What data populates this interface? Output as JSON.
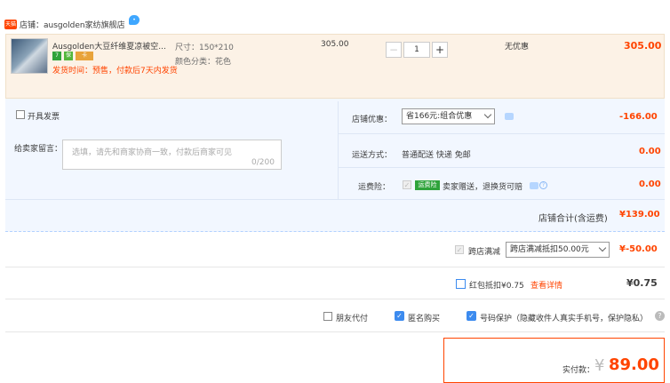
{
  "shop": {
    "badge": "天猫",
    "name": "店铺：ausgolden家纺旗舰店",
    "chat_icon": "chat-bubble-icon"
  },
  "item": {
    "title": "Ausgolden大豆纤维夏凉被空...",
    "tags": [
      "7",
      "保",
      "卡"
    ],
    "ship_note": "发货时间：预售，付款后7天内发货",
    "sku_size": "尺寸：150*210",
    "sku_color": "颜色分类：花色",
    "unit_price": "305.00",
    "quantity": "1",
    "minus": "−",
    "plus": "+",
    "discount": "无优惠",
    "subtotal": "305.00"
  },
  "invoice": {
    "label": "开具发票"
  },
  "message": {
    "label": "给卖家留言：",
    "placeholder": "选填，请先和商家协商一致，付款后商家可见",
    "counter": "0/200"
  },
  "shop_discount": {
    "label": "店铺优惠：",
    "selected": "省166元:组合优惠",
    "value": "-166.00"
  },
  "shipping": {
    "label": "运送方式：",
    "method": "普通配送 快递 免邮",
    "value": "0.00"
  },
  "insurance": {
    "label": "运费险：",
    "badge": "运费险",
    "text": "卖家赠送，退换货可赔",
    "value": "0.00"
  },
  "shop_total": {
    "label": "店铺合计(含运费)",
    "value": "¥139.00"
  },
  "cross_store": {
    "label": "跨店满减",
    "selected": "跨店满减抵扣50.00元",
    "value": "¥-50.00"
  },
  "red_packet": {
    "label": "红包抵扣¥0.75",
    "link": "查看详情",
    "value": "¥0.75"
  },
  "options": {
    "friend_pay": "朋友代付",
    "anonymous": "匿名购买",
    "number_protect": "号码保护（隐藏收件人真实手机号，保护隐私）"
  },
  "payment": {
    "label": "实付款：",
    "currency": "¥",
    "amount": "89.00"
  },
  "colors": {
    "accent": "#ff4400",
    "panel_bg": "#f2f7ff",
    "check_blue": "#3c8bef"
  }
}
